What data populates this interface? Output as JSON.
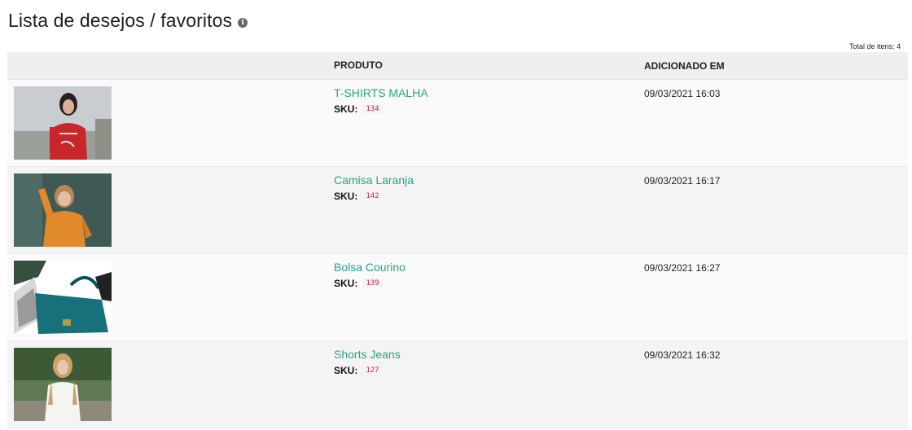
{
  "header": {
    "title": "Lista de desejos / favoritos",
    "info_icon": "info-icon"
  },
  "total_label": "Total de itens: 4",
  "table": {
    "columns": [
      "",
      "PRODUTO",
      "ADICIONADO EM"
    ],
    "rows": [
      {
        "name": "T-SHIRTS MALHA",
        "sku_label": "SKU:",
        "sku": "134",
        "added": "09/03/2021 16:03"
      },
      {
        "name": "Camisa Laranja",
        "sku_label": "SKU:",
        "sku": "142",
        "added": "09/03/2021 16:17"
      },
      {
        "name": "Bolsa Courino",
        "sku_label": "SKU:",
        "sku": "139",
        "added": "09/03/2021 16:27"
      },
      {
        "name": "Shorts Jeans",
        "sku_label": "SKU:",
        "sku": "127",
        "added": "09/03/2021 16:32"
      }
    ]
  },
  "colors": {
    "link": "#2aa08a",
    "sku_code": "#c7254e",
    "header_bg": "#efefef"
  }
}
